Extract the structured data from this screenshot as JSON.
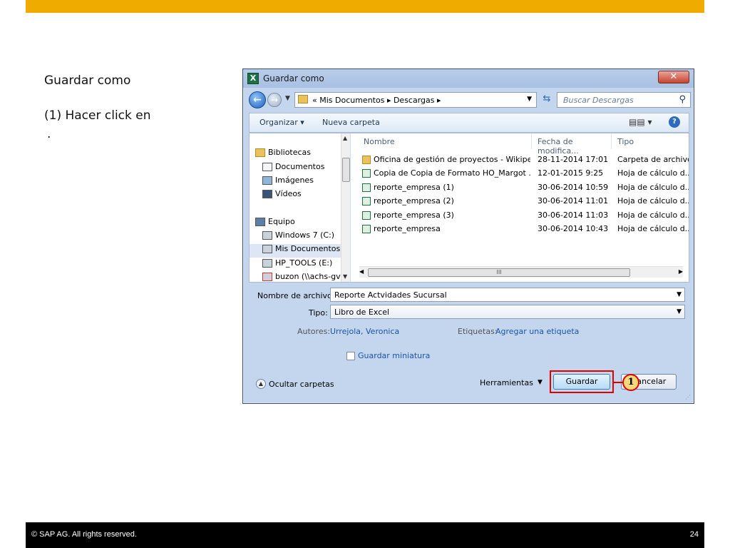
{
  "slide": {
    "heading": "Guardar como",
    "instruction": "(1) Hacer click en",
    "bullet": ".",
    "footer_copyright": "©  SAP AG. All rights reserved.",
    "page_number": "24"
  },
  "dialog": {
    "title": "Guardar como",
    "close_label": "✕",
    "address": {
      "crumbs": "«  Mis Documentos  ▸  Descargas  ▸",
      "search_placeholder": "Buscar Descargas"
    },
    "toolbar": {
      "organizar": "Organizar ▾",
      "nueva_carpeta": "Nueva carpeta",
      "views": "▤▤ ▾",
      "help": "?"
    },
    "nav_items": [
      {
        "label": "Bibliotecas"
      },
      {
        "label": "Documentos"
      },
      {
        "label": "Imágenes"
      },
      {
        "label": "Vídeos"
      },
      {
        "label": "Equipo"
      },
      {
        "label": "Windows 7 (C:)"
      },
      {
        "label": "Mis Documentos"
      },
      {
        "label": "HP_TOOLS (E:)"
      },
      {
        "label": "buzon (\\\\achs-gv"
      }
    ],
    "columns": {
      "nombre": "Nombre",
      "fecha": "Fecha de modifica...",
      "tipo": "Tipo"
    },
    "files": [
      {
        "name": "Oficina de gestión de proyectos - Wikipe...",
        "date": "28-11-2014 17:01",
        "type": "Carpeta de archivos"
      },
      {
        "name": "Copia de Copia de Formato HO_Margot ...",
        "date": "12-01-2015 9:25",
        "type": "Hoja de cálculo d..."
      },
      {
        "name": "reporte_empresa (1)",
        "date": "30-06-2014 10:59",
        "type": "Hoja de cálculo d..."
      },
      {
        "name": "reporte_empresa (2)",
        "date": "30-06-2014 11:01",
        "type": "Hoja de cálculo d..."
      },
      {
        "name": "reporte_empresa (3)",
        "date": "30-06-2014 11:03",
        "type": "Hoja de cálculo d..."
      },
      {
        "name": "reporte_empresa",
        "date": "30-06-2014 10:43",
        "type": "Hoja de cálculo d..."
      }
    ],
    "form": {
      "filename_label": "Nombre de archivo:",
      "filename_value": "Reporte Actvidades Sucursal",
      "type_label": "Tipo:",
      "type_value": "Libro de Excel",
      "authors_label": "Autores:",
      "authors_value": "Urrejola, Veronica",
      "tags_label": "Etiquetas:",
      "tags_value": "Agregar una etiqueta",
      "thumbnail_label": "Guardar miniatura"
    },
    "footer": {
      "hide_folders": "Ocultar carpetas",
      "tools": "Herramientas",
      "save": "Guardar",
      "cancel": "Cancelar",
      "callout_number": "1"
    }
  },
  "colors": {
    "accent_bar": "#f0ab00",
    "highlight": "#e00000"
  }
}
